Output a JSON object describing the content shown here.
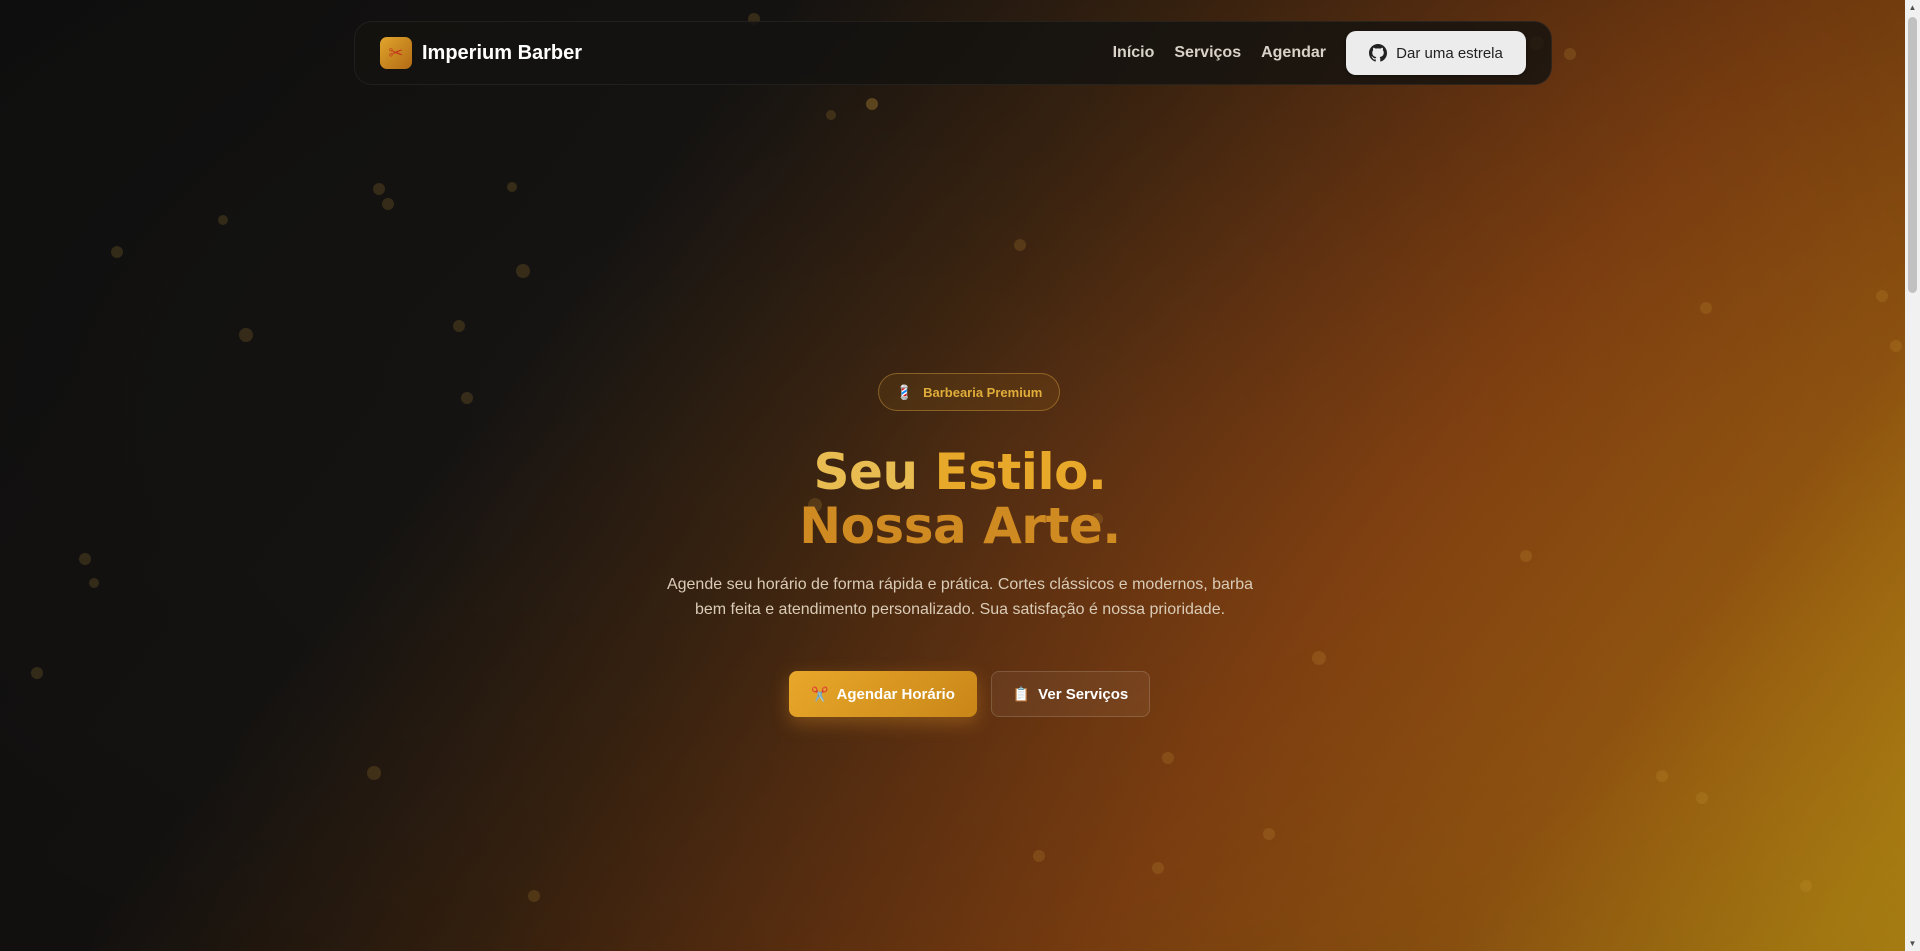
{
  "brand": {
    "name": "Imperium Barber",
    "logo_icon": "scissors-logo-icon"
  },
  "nav": {
    "links": [
      {
        "label": "Início"
      },
      {
        "label": "Serviços"
      },
      {
        "label": "Agendar"
      }
    ],
    "star_button": {
      "label": "Dar uma estrela",
      "icon": "github-icon"
    }
  },
  "hero": {
    "badge": {
      "label": "Barbearia Premium",
      "icon": "barber-pole-icon"
    },
    "title_line1_part1": "Seu ",
    "title_line1_part2": "Estilo.",
    "title_line2": "Nossa Arte.",
    "subtitle": "Agende seu horário de forma rápida e prática. Cortes clássicos e modernos, barba bem feita e atendimento personalizado. Sua satisfação é nossa prioridade.",
    "primary_button": {
      "label": "Agendar Horário",
      "icon": "scissors-icon"
    },
    "secondary_button": {
      "label": "Ver Serviços",
      "icon": "clipboard-icon"
    }
  },
  "colors": {
    "accent": "#e8a82a",
    "background_dark": "#121212",
    "background_warm": "#8a4512",
    "background_gold": "#dca41a"
  }
}
